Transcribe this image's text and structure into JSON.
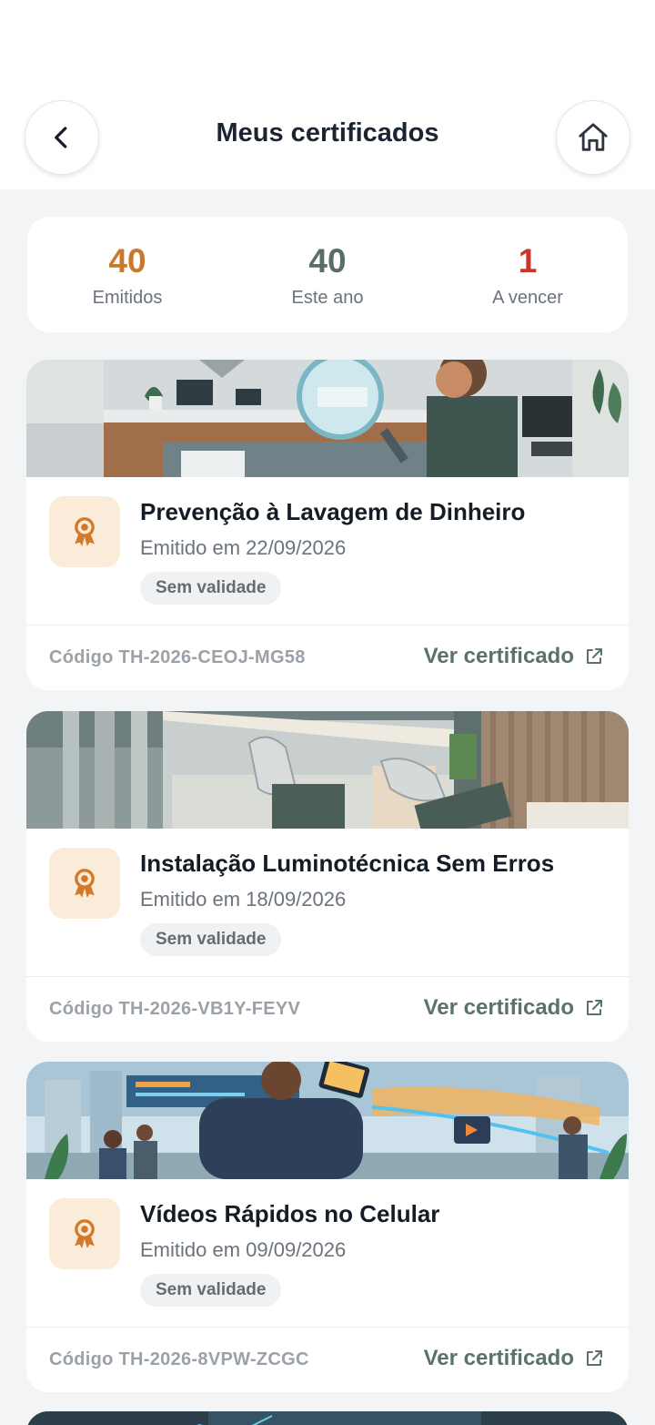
{
  "header": {
    "title": "Meus certificados",
    "back_icon": "chevron-left-icon",
    "home_icon": "home-icon"
  },
  "stats": [
    {
      "value": "40",
      "label": "Emitidos",
      "color": "#c9792c"
    },
    {
      "value": "40",
      "label": "Este ano",
      "color": "#5a6e68"
    },
    {
      "value": "1",
      "label": "A vencer",
      "color": "#c8352c"
    }
  ],
  "certificates": [
    {
      "title": "Prevenção à Lavagem de Dinheiro",
      "issued": "Emitido em 22/09/2026",
      "validity": "Sem validade",
      "code": "Código TH-2026-CEOJ-MG58",
      "link": "Ver certificado"
    },
    {
      "title": "Instalação Luminotécnica Sem Erros",
      "issued": "Emitido em 18/09/2026",
      "validity": "Sem validade",
      "code": "Código TH-2026-VB1Y-FEYV",
      "link": "Ver certificado"
    },
    {
      "title": "Vídeos Rápidos no Celular",
      "issued": "Emitido em 09/09/2026",
      "validity": "Sem validade",
      "code": "Código TH-2026-8VPW-ZCGC",
      "link": "Ver certificado"
    }
  ],
  "colors": {
    "accent_orange": "#c9792c",
    "link_green": "#5b7268",
    "badge_bg": "#fbecd9"
  }
}
